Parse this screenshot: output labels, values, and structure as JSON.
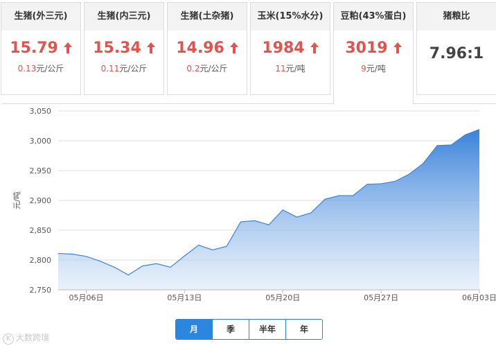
{
  "cards": [
    {
      "title": "生猪(外三元)",
      "value": "15.79",
      "change": "0.13",
      "unit": "元/公斤",
      "trend": "up",
      "active": false
    },
    {
      "title": "生猪(内三元)",
      "value": "15.34",
      "change": "0.11",
      "unit": "元/公斤",
      "trend": "up",
      "active": false
    },
    {
      "title": "生猪(土杂猪)",
      "value": "14.96",
      "change": "0.2",
      "unit": "元/公斤",
      "trend": "up",
      "active": false
    },
    {
      "title": "玉米(15%水分)",
      "value": "1984",
      "change": "11",
      "unit": "元/吨",
      "trend": "up",
      "active": false
    },
    {
      "title": "豆粕(43%蛋白)",
      "value": "3019",
      "change": "9",
      "unit": "元/吨",
      "trend": "up",
      "active": true
    },
    {
      "title": "猪粮比",
      "value": "7.96:1",
      "change": "",
      "unit": "",
      "trend": "none",
      "active": false
    }
  ],
  "colors": {
    "up": "#e0534e",
    "accent": "#2b86e0",
    "line": "#3a84dd"
  },
  "chart_data": {
    "type": "area",
    "title": "",
    "xlabel": "",
    "ylabel": "元/吨",
    "ylim": [
      2750,
      3050
    ],
    "yticks": [
      "2,750",
      "2,800",
      "2,850",
      "2,900",
      "2,950",
      "3,000",
      "3,050"
    ],
    "ytick_values": [
      2750,
      2800,
      2850,
      2900,
      2950,
      3000,
      3050
    ],
    "xticks": [
      "05月06日",
      "05月13日",
      "05月20日",
      "05月27日",
      "06月03日"
    ],
    "xtick_index": [
      2,
      9,
      16,
      23,
      30
    ],
    "x": [
      "05月04日",
      "05月05日",
      "05月06日",
      "05月07日",
      "05月08日",
      "05月09日",
      "05月10日",
      "05月11日",
      "05月12日",
      "05月13日",
      "05月14日",
      "05月15日",
      "05月16日",
      "05月17日",
      "05月18日",
      "05月19日",
      "05月20日",
      "05月21日",
      "05月22日",
      "05月23日",
      "05月24日",
      "05月25日",
      "05月26日",
      "05月27日",
      "05月28日",
      "05月29日",
      "05月30日",
      "05月31日",
      "06月01日",
      "06月02日",
      "06月03日"
    ],
    "values": [
      2811,
      2810,
      2806,
      2798,
      2788,
      2775,
      2790,
      2794,
      2788,
      2807,
      2825,
      2817,
      2823,
      2864,
      2866,
      2859,
      2884,
      2872,
      2879,
      2902,
      2908,
      2908,
      2927,
      2928,
      2932,
      2944,
      2962,
      2992,
      2993,
      3010,
      3019
    ],
    "grid": true,
    "legend": "none"
  },
  "tabs": [
    {
      "label": "月",
      "active": true
    },
    {
      "label": "季",
      "active": false
    },
    {
      "label": "半年",
      "active": false
    },
    {
      "label": "年",
      "active": false
    }
  ],
  "watermark": {
    "icon": "logo-icon",
    "text": "大数跨境"
  }
}
